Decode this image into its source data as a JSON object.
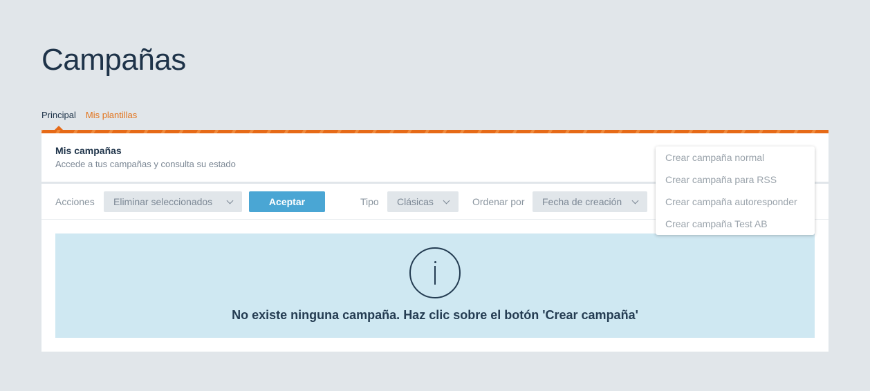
{
  "page": {
    "title": "Campañas"
  },
  "tabs": [
    {
      "label": "Principal",
      "active": true
    },
    {
      "label": "Mis plantillas",
      "active": false
    }
  ],
  "panel": {
    "title": "Mis campañas",
    "subtitle": "Accede a tus campañas y consulta su estado"
  },
  "toolbar": {
    "actions_label": "Acciones",
    "actions_value": "Eliminar seleccionados",
    "accept_label": "Aceptar",
    "type_label": "Tipo",
    "type_value": "Clásicas",
    "order_label": "Ordenar por",
    "order_value": "Fecha de creación"
  },
  "empty_state": {
    "icon": "info-icon",
    "message": "No existe ninguna campaña. Haz clic sobre el botón 'Crear campaña'"
  },
  "create_menu": {
    "items": [
      "Crear campaña normal",
      "Crear campaña para RSS",
      "Crear campaña autoresponder",
      "Crear campaña Test AB"
    ]
  },
  "colors": {
    "accent": "#e66a17",
    "button": "#4aa6d4",
    "info_bg": "#cfe8f2",
    "page_bg": "#e1e6ea"
  }
}
